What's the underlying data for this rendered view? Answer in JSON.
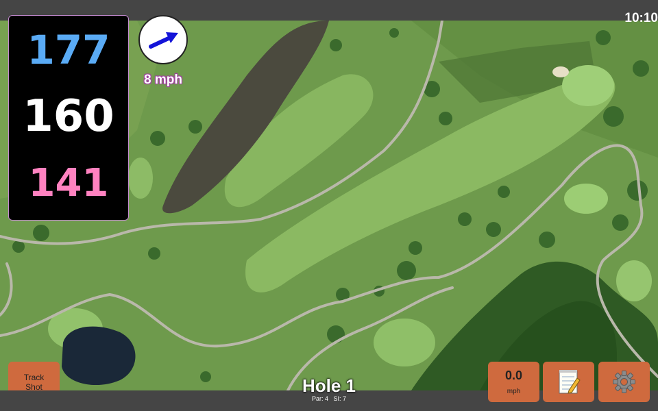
{
  "status_bar": {
    "time": "10:10"
  },
  "distances": {
    "back": "177",
    "middle": "160",
    "front": "141"
  },
  "wind": {
    "speed": "8 mph",
    "icon": "wind-direction-arrow-icon"
  },
  "track_shot": {
    "label": "Track\nShot"
  },
  "speed_button": {
    "value": "0.0",
    "unit": "mph"
  },
  "notes_button": {
    "icon": "notepad-icon"
  },
  "settings_button": {
    "icon": "gear-icon"
  },
  "hole": {
    "title": "Hole 1",
    "par_label": "Par: 4",
    "si_label": "SI: 7"
  },
  "colors": {
    "back": "#5aabf5",
    "middle": "#ffffff",
    "front": "#ff82c0",
    "button": "#cf6a3e"
  }
}
